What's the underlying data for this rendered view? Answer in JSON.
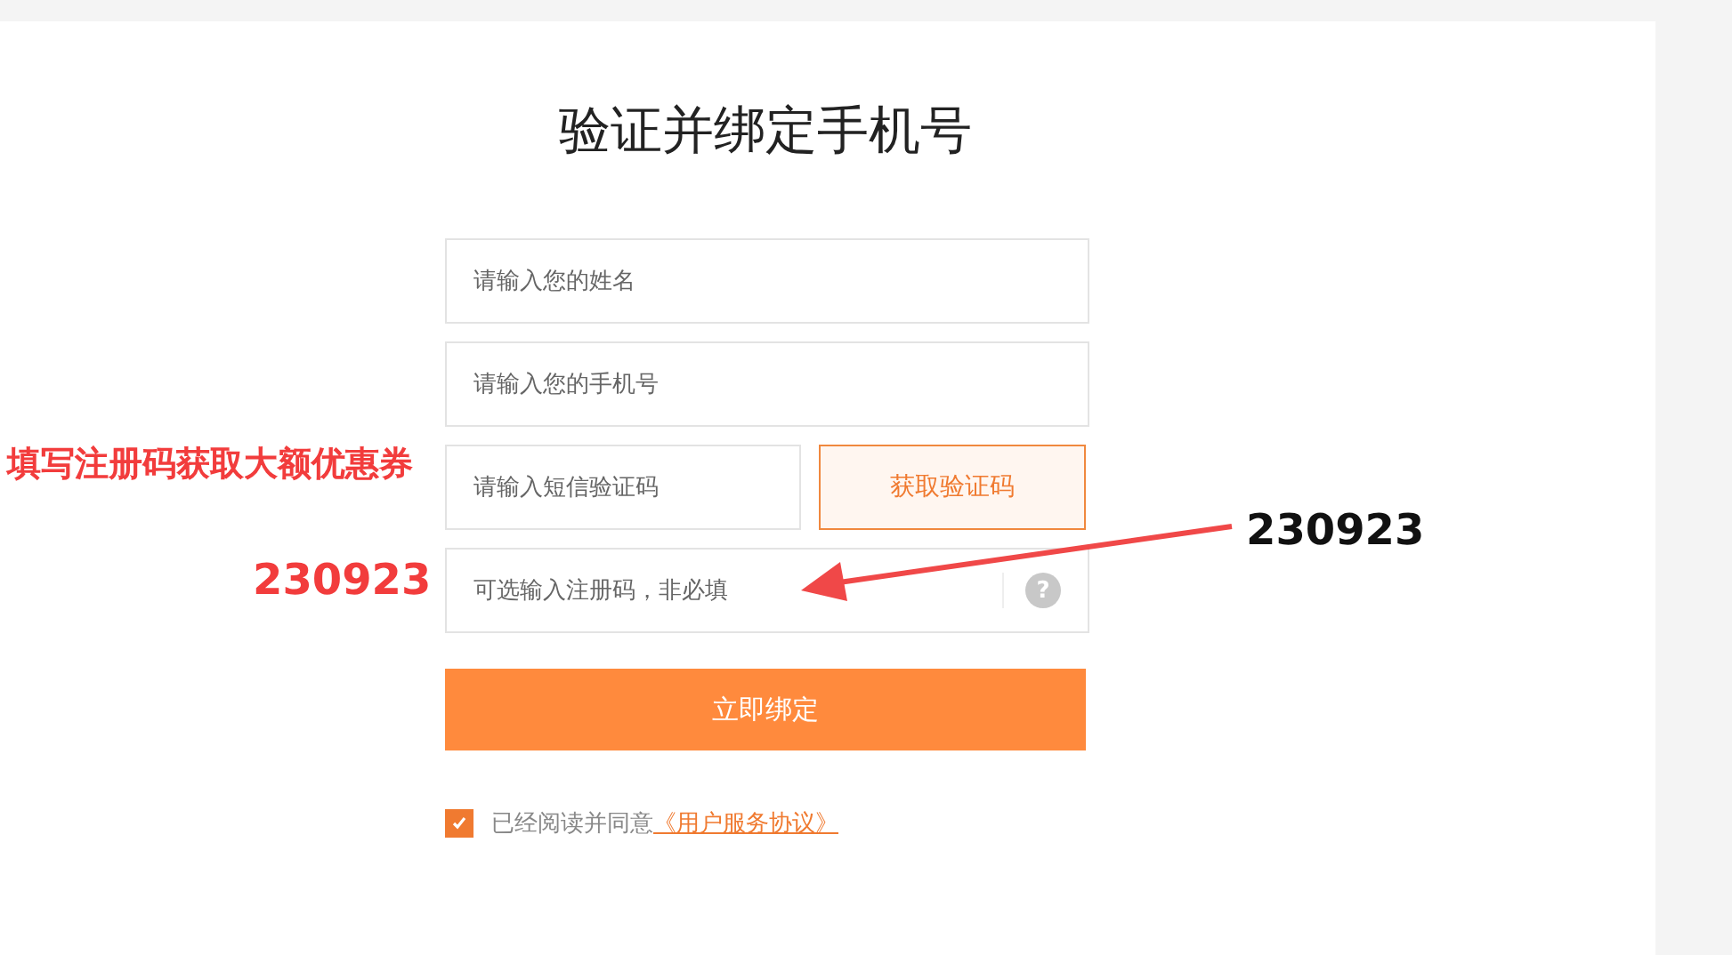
{
  "title": "验证并绑定手机号",
  "fields": [
    {
      "placeholder": "请输入您的姓名"
    },
    {
      "placeholder": "请输入您的手机号"
    }
  ],
  "code_field": {
    "placeholder": "请输入短信验证码"
  },
  "code_button": "获取验证码",
  "register_field": {
    "placeholder": "可选输入注册码，非必填",
    "help": "?"
  },
  "submit": "立即绑定",
  "agreement": {
    "checked": true,
    "text": "已经阅读并同意",
    "link": "《用户服务协议》"
  },
  "annotations": {
    "headline": "填写注册码获取大额优惠券",
    "code_overlay": "230923",
    "code_label": "230923"
  }
}
